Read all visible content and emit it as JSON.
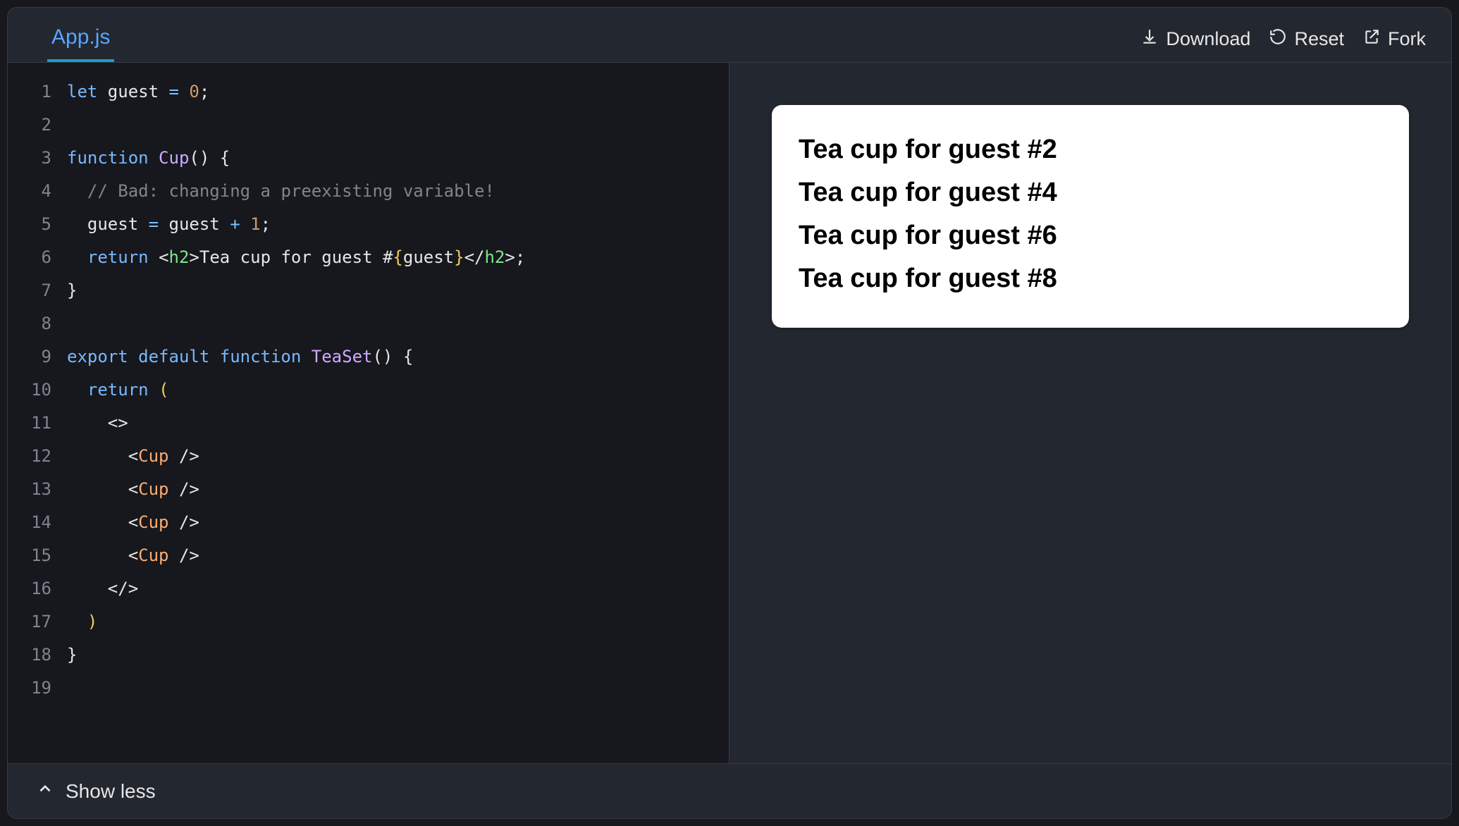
{
  "tab": {
    "label": "App.js"
  },
  "actions": {
    "download": "Download",
    "reset": "Reset",
    "fork": "Fork"
  },
  "code": {
    "lines": [
      {
        "n": 1,
        "segments": [
          {
            "t": "let ",
            "c": "tok-kw"
          },
          {
            "t": "guest ",
            "c": ""
          },
          {
            "t": "= ",
            "c": "tok-op"
          },
          {
            "t": "0",
            "c": "tok-num"
          },
          {
            "t": ";",
            "c": ""
          }
        ]
      },
      {
        "n": 2,
        "segments": []
      },
      {
        "n": 3,
        "segments": [
          {
            "t": "function ",
            "c": "tok-kw"
          },
          {
            "t": "Cup",
            "c": "tok-fn"
          },
          {
            "t": "() {",
            "c": ""
          }
        ]
      },
      {
        "n": 4,
        "segments": [
          {
            "t": "  ",
            "c": ""
          },
          {
            "t": "// Bad: changing a preexisting variable!",
            "c": "tok-comment"
          }
        ]
      },
      {
        "n": 5,
        "segments": [
          {
            "t": "  guest ",
            "c": ""
          },
          {
            "t": "= ",
            "c": "tok-op"
          },
          {
            "t": "guest ",
            "c": ""
          },
          {
            "t": "+ ",
            "c": "tok-op"
          },
          {
            "t": "1",
            "c": "tok-num"
          },
          {
            "t": ";",
            "c": ""
          }
        ]
      },
      {
        "n": 6,
        "segments": [
          {
            "t": "  ",
            "c": ""
          },
          {
            "t": "return ",
            "c": "tok-kw"
          },
          {
            "t": "<",
            "c": ""
          },
          {
            "t": "h2",
            "c": "tok-tag"
          },
          {
            "t": ">",
            "c": ""
          },
          {
            "t": "Tea cup for guest #",
            "c": ""
          },
          {
            "t": "{",
            "c": "tok-paren"
          },
          {
            "t": "guest",
            "c": ""
          },
          {
            "t": "}",
            "c": "tok-paren"
          },
          {
            "t": "</",
            "c": ""
          },
          {
            "t": "h2",
            "c": "tok-tag"
          },
          {
            "t": ">;",
            "c": ""
          }
        ]
      },
      {
        "n": 7,
        "segments": [
          {
            "t": "}",
            "c": ""
          }
        ]
      },
      {
        "n": 8,
        "segments": []
      },
      {
        "n": 9,
        "segments": [
          {
            "t": "export default function ",
            "c": "tok-kw"
          },
          {
            "t": "TeaSet",
            "c": "tok-fn"
          },
          {
            "t": "() {",
            "c": ""
          }
        ]
      },
      {
        "n": 10,
        "segments": [
          {
            "t": "  ",
            "c": ""
          },
          {
            "t": "return ",
            "c": "tok-kw"
          },
          {
            "t": "(",
            "c": "tok-paren"
          }
        ]
      },
      {
        "n": 11,
        "segments": [
          {
            "t": "    <>",
            "c": ""
          }
        ]
      },
      {
        "n": 12,
        "segments": [
          {
            "t": "      <",
            "c": ""
          },
          {
            "t": "Cup ",
            "c": "tok-attr"
          },
          {
            "t": "/>",
            "c": ""
          }
        ]
      },
      {
        "n": 13,
        "segments": [
          {
            "t": "      <",
            "c": ""
          },
          {
            "t": "Cup ",
            "c": "tok-attr"
          },
          {
            "t": "/>",
            "c": ""
          }
        ]
      },
      {
        "n": 14,
        "segments": [
          {
            "t": "      <",
            "c": ""
          },
          {
            "t": "Cup ",
            "c": "tok-attr"
          },
          {
            "t": "/>",
            "c": ""
          }
        ]
      },
      {
        "n": 15,
        "segments": [
          {
            "t": "      <",
            "c": ""
          },
          {
            "t": "Cup ",
            "c": "tok-attr"
          },
          {
            "t": "/>",
            "c": ""
          }
        ]
      },
      {
        "n": 16,
        "segments": [
          {
            "t": "    </>",
            "c": ""
          }
        ]
      },
      {
        "n": 17,
        "segments": [
          {
            "t": "  ",
            "c": ""
          },
          {
            "t": ")",
            "c": "tok-paren"
          }
        ]
      },
      {
        "n": 18,
        "segments": [
          {
            "t": "}",
            "c": ""
          }
        ]
      },
      {
        "n": 19,
        "segments": []
      }
    ]
  },
  "preview": {
    "items": [
      "Tea cup for guest #2",
      "Tea cup for guest #4",
      "Tea cup for guest #6",
      "Tea cup for guest #8"
    ]
  },
  "footer": {
    "toggle": "Show less"
  }
}
